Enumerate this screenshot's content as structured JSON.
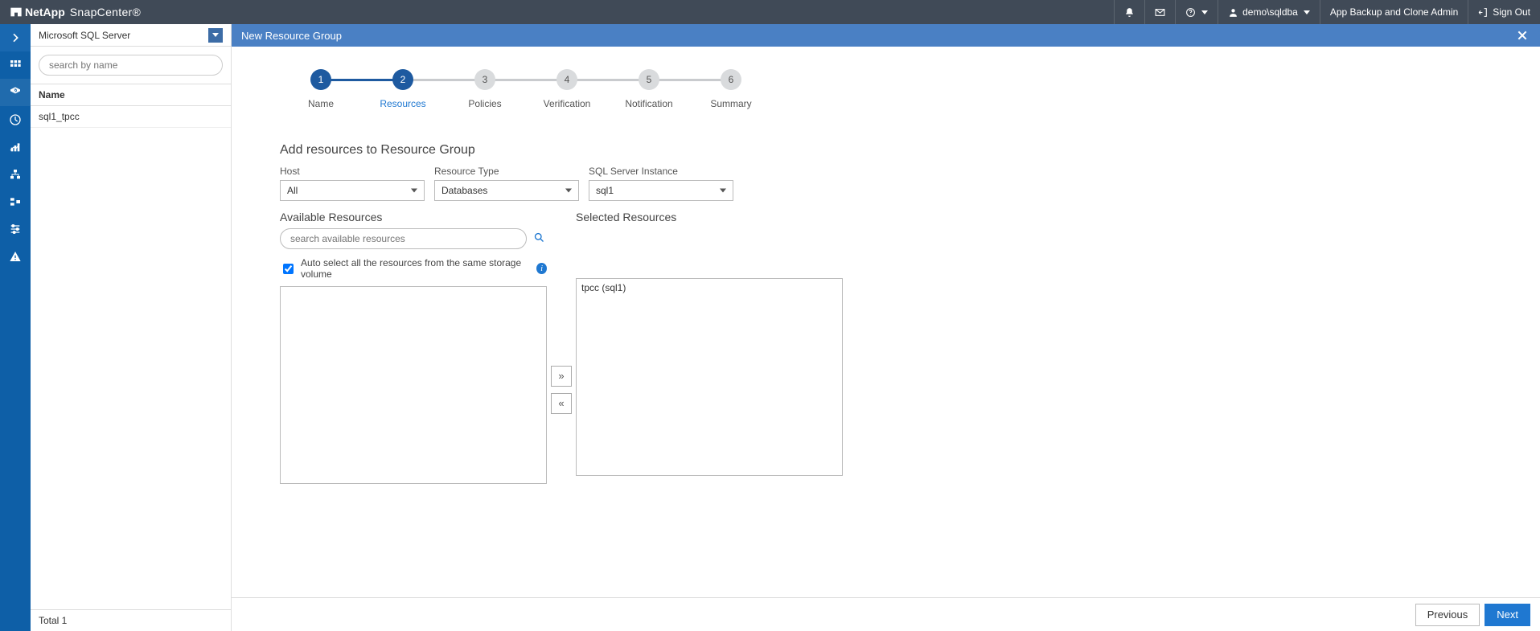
{
  "brand": {
    "company": "NetApp",
    "product": "SnapCenter®"
  },
  "topbar": {
    "user": "demo\\sqldba",
    "role": "App Backup and Clone Admin",
    "signout": "Sign Out"
  },
  "side": {
    "plugin": "Microsoft SQL Server",
    "search_placeholder": "search by name",
    "col_header": "Name",
    "rows": [
      "sql1_tpcc"
    ],
    "total_label": "Total 1"
  },
  "page": {
    "title": "New Resource Group"
  },
  "wizard": {
    "steps": [
      {
        "n": "1",
        "label": "Name",
        "active": true,
        "sel": false,
        "line_on": true
      },
      {
        "n": "2",
        "label": "Resources",
        "active": true,
        "sel": true,
        "line_on": false
      },
      {
        "n": "3",
        "label": "Policies",
        "active": false,
        "sel": false,
        "line_on": false
      },
      {
        "n": "4",
        "label": "Verification",
        "active": false,
        "sel": false,
        "line_on": false
      },
      {
        "n": "5",
        "label": "Notification",
        "active": false,
        "sel": false,
        "line_on": false
      },
      {
        "n": "6",
        "label": "Summary",
        "active": false,
        "sel": false,
        "line_on": false
      }
    ]
  },
  "form": {
    "title": "Add resources to Resource Group",
    "host_label": "Host",
    "host_value": "All",
    "type_label": "Resource Type",
    "type_value": "Databases",
    "inst_label": "SQL Server Instance",
    "inst_value": "sql1",
    "avail_title": "Available Resources",
    "sel_title": "Selected Resources",
    "search_av_placeholder": "search available resources",
    "auto_label": "Auto select all the resources from the same storage volume",
    "selected_items": [
      "tpcc (sql1)"
    ],
    "move_right": "»",
    "move_left": "«"
  },
  "footer": {
    "prev": "Previous",
    "next": "Next"
  }
}
